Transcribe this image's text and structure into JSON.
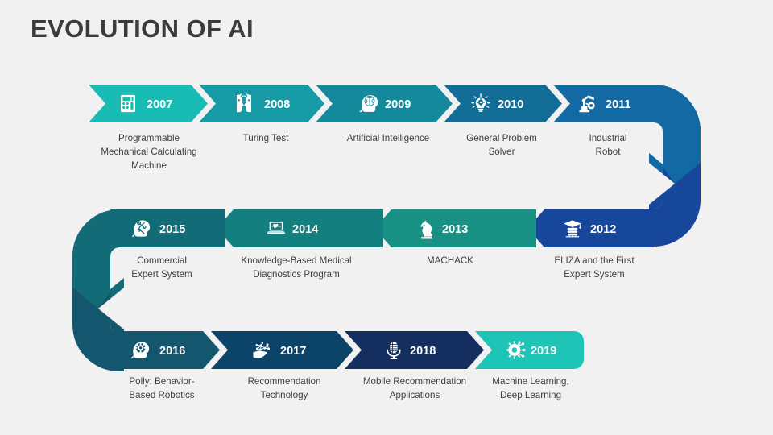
{
  "header": {
    "title": "EVOLUTION OF AI"
  },
  "theme": {
    "background": "#f1f1f1",
    "title_color": "#3b3b3b",
    "label_color": "#404040",
    "year_color": "#ffffff",
    "gap_color": "#f1f1f1"
  },
  "timeline": {
    "rows": [
      {
        "index": 0,
        "direction": "left-to-right"
      },
      {
        "index": 1,
        "direction": "right-to-left"
      },
      {
        "index": 2,
        "direction": "left-to-right"
      }
    ],
    "items": [
      {
        "year": "2007",
        "label": "Programmable\nMechanical Calculating\nMachine",
        "icon": "calculator-icon",
        "color": "#18bcb5",
        "row": 0,
        "order": 1
      },
      {
        "year": "2008",
        "label": "Turing Test",
        "icon": "two-faces-icon",
        "color": "#169ba6",
        "row": 0,
        "order": 2
      },
      {
        "year": "2009",
        "label": "Artificial Intelligence",
        "icon": "brain-head-icon",
        "color": "#14899c",
        "row": 0,
        "order": 3
      },
      {
        "year": "2010",
        "label": "General Problem\nSolver",
        "icon": "lightbulb-gear-icon",
        "color": "#126d96",
        "row": 0,
        "order": 4
      },
      {
        "year": "2011",
        "label": "Industrial\nRobot",
        "icon": "robot-arm-icon",
        "color": "#1269a4",
        "row": 0,
        "order": 5
      },
      {
        "year": "2012",
        "label": "ELIZA and the First\nExpert System",
        "icon": "graduation-cap-icon",
        "color": "#16479b",
        "row": 1,
        "order": 1
      },
      {
        "year": "2013",
        "label": "MACHACK",
        "icon": "chess-knight-icon",
        "color": "#189184",
        "row": 1,
        "order": 2
      },
      {
        "year": "2014",
        "label": "Knowledge-Based Medical\nDiagnostics Program",
        "icon": "laptop-heart-icon",
        "color": "#13807f",
        "row": 1,
        "order": 3
      },
      {
        "year": "2015",
        "label": "Commercial\nExpert System",
        "icon": "head-tools-icon",
        "color": "#136b77",
        "row": 1,
        "order": 4
      },
      {
        "year": "2016",
        "label": "Polly: Behavior-\nBased Robotics",
        "icon": "head-gear-icon",
        "color": "#14566e",
        "row": 2,
        "order": 1
      },
      {
        "year": "2017",
        "label": "Recommendation\nTechnology",
        "icon": "hand-network-icon",
        "color": "#0c4469",
        "row": 2,
        "order": 2
      },
      {
        "year": "2018",
        "label": "Mobile Recommendation\nApplications",
        "icon": "microphone-icon",
        "color": "#142f5f",
        "row": 2,
        "order": 3
      },
      {
        "year": "2019",
        "label": "Machine Learning,\nDeep Learning",
        "icon": "ai-chip-icon",
        "color": "#1ec5b6",
        "row": 2,
        "order": 4
      }
    ],
    "connectors": [
      {
        "name": "right-u-turn",
        "from_year": "2011",
        "to_year": "2012",
        "top_color": "#1269a4",
        "bottom_color": "#16479b"
      },
      {
        "name": "left-u-turn",
        "from_year": "2015",
        "to_year": "2016",
        "top_color": "#136b77",
        "bottom_color": "#14566e"
      }
    ]
  }
}
